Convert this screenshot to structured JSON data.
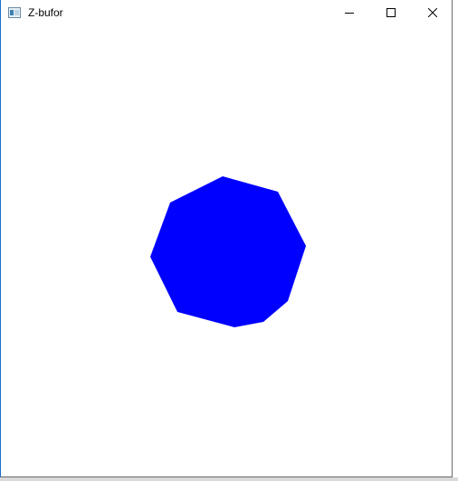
{
  "window": {
    "title": "Z-bufor"
  },
  "icons": {
    "app": "app-window-icon",
    "minimize": "minimize-icon",
    "maximize": "maximize-icon",
    "close": "close-icon"
  },
  "scene": {
    "shape": "octagon",
    "fill_color": "#0000ff"
  }
}
